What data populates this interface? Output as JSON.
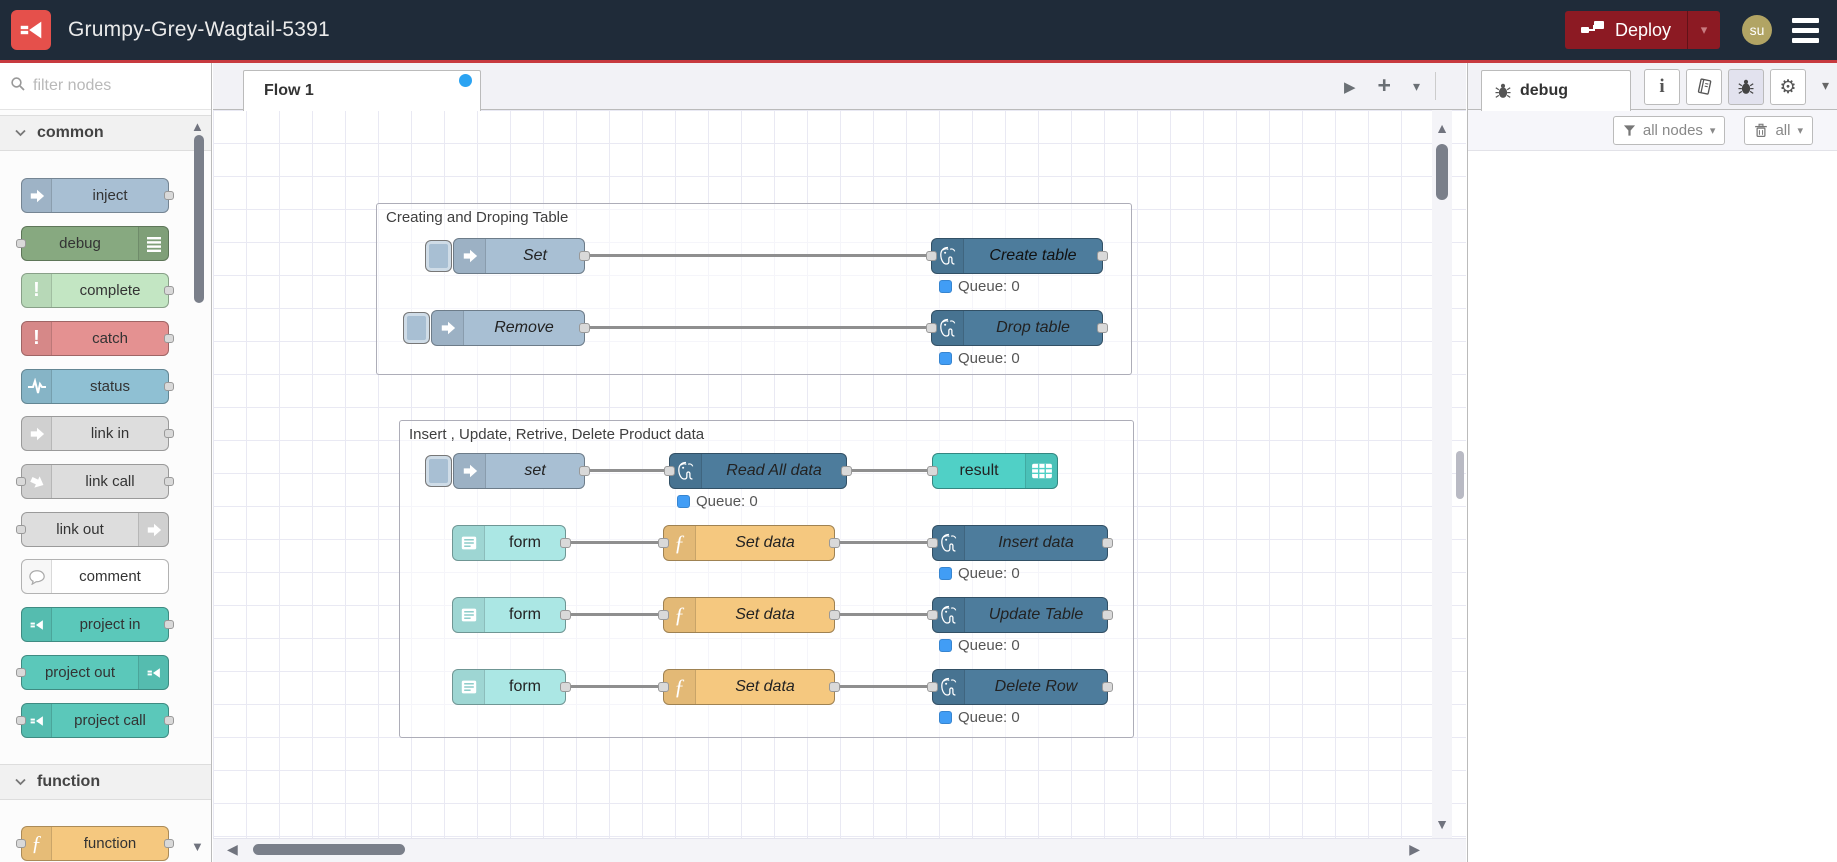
{
  "header": {
    "title": "Grumpy-Grey-Wagtail-5391",
    "deploy": {
      "label": "Deploy"
    },
    "avatar": {
      "text": "su"
    }
  },
  "palette": {
    "filter_placeholder": "filter nodes",
    "sections": [
      {
        "label": "common"
      },
      {
        "label": "function"
      }
    ],
    "nodes": [
      {
        "label": "inject",
        "color": "#a8bfd3"
      },
      {
        "label": "debug",
        "color": "#87a980"
      },
      {
        "label": "complete",
        "color": "#c3e6c3"
      },
      {
        "label": "catch",
        "color": "#e49191"
      },
      {
        "label": "status",
        "color": "#8fc0d3"
      },
      {
        "label": "link in",
        "color": "#dddddd"
      },
      {
        "label": "link call",
        "color": "#dddddd"
      },
      {
        "label": "link out",
        "color": "#dddddd"
      },
      {
        "label": "comment",
        "color": "#ffffff"
      },
      {
        "label": "project in",
        "color": "#5bc8ba"
      },
      {
        "label": "project out",
        "color": "#5bc8ba"
      },
      {
        "label": "project call",
        "color": "#5bc8ba"
      },
      {
        "label": "function",
        "color": "#f5c87f"
      }
    ]
  },
  "workspace": {
    "tabs": [
      {
        "label": "Flow 1",
        "modified": true
      }
    ],
    "groups": [
      {
        "title": "Creating and Droping Table"
      },
      {
        "title": "Insert , Update, Retrive, Delete Product data"
      }
    ],
    "nodes": {
      "set1": "Set",
      "remove": "Remove",
      "create_table": "Create table",
      "drop_table": "Drop table",
      "set2": "set",
      "read_all": "Read All data",
      "result": "result",
      "form1": "form",
      "form2": "form",
      "form3": "form",
      "setdata1": "Set data",
      "setdata2": "Set data",
      "setdata3": "Set data",
      "insert": "Insert data",
      "update": "Update Table",
      "delete": "Delete Row"
    },
    "status_text": "Queue: 0"
  },
  "sidebar": {
    "tab_label": "debug",
    "filter_label": "all nodes",
    "clear_label": "all"
  },
  "colors": {
    "header_bg": "#1f2b39",
    "accent_red": "#c73a3f",
    "logo_red": "#e5504b",
    "deploy_bg": "#8c1a23",
    "avatar_bg": "#b1a464",
    "inject_node": "#a8bfd3",
    "postgres_node": "#4d7c9c",
    "function_node": "#f5c87f",
    "form_node": "#abe7e4",
    "result_node": "#50d0c6",
    "status_blue": "#419df5",
    "tab_dot_blue": "#2ba3f2"
  }
}
